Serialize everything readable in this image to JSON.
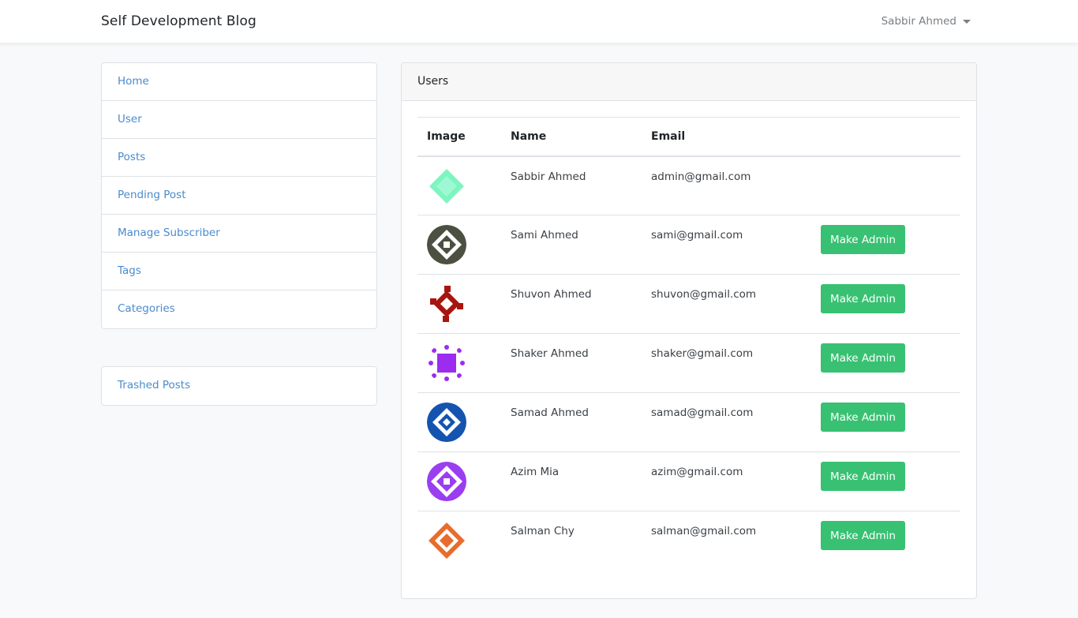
{
  "header": {
    "brand": "Self Development Blog",
    "user_name": "Sabbir Ahmed"
  },
  "sidebar": {
    "items": [
      {
        "label": "Home"
      },
      {
        "label": "User"
      },
      {
        "label": "Posts"
      },
      {
        "label": "Pending Post"
      },
      {
        "label": "Manage Subscriber"
      },
      {
        "label": "Tags"
      },
      {
        "label": "Categories"
      }
    ],
    "trash": {
      "label": "Trashed Posts"
    }
  },
  "users_card": {
    "title": "Users",
    "columns": {
      "image": "Image",
      "name": "Name",
      "email": "Email"
    },
    "rows": [
      {
        "name": "Sabbir Ahmed",
        "email": "admin@gmail.com",
        "avatar_color": "#7ef5c0",
        "action": ""
      },
      {
        "name": "Sami Ahmed",
        "email": "sami@gmail.com",
        "avatar_color": "#4b5040",
        "action": "Make Admin"
      },
      {
        "name": "Shuvon Ahmed",
        "email": "shuvon@gmail.com",
        "avatar_color": "#a8150f",
        "action": "Make Admin"
      },
      {
        "name": "Shaker Ahmed",
        "email": "shaker@gmail.com",
        "avatar_color": "#9b2cf0",
        "action": "Make Admin"
      },
      {
        "name": "Samad Ahmed",
        "email": "samad@gmail.com",
        "avatar_color": "#1454b0",
        "action": "Make Admin"
      },
      {
        "name": "Azim Mia",
        "email": "azim@gmail.com",
        "avatar_color": "#9a3ef0",
        "action": "Make Admin"
      },
      {
        "name": "Salman Chy",
        "email": "salman@gmail.com",
        "avatar_color": "#e86c2c",
        "action": "Make Admin"
      }
    ]
  },
  "colors": {
    "accent_link": "#4a8bcd",
    "button_success": "#38c172"
  }
}
